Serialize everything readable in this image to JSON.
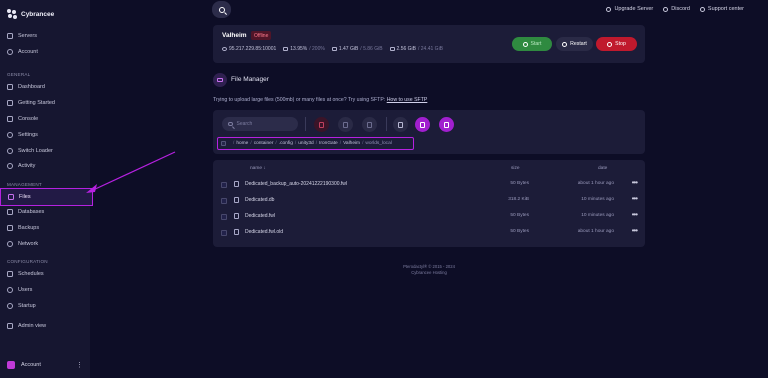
{
  "app": {
    "name": "Cybrancee"
  },
  "sidebar": {
    "top_items": [
      {
        "label": "Servers"
      },
      {
        "label": "Account"
      }
    ],
    "sections": [
      {
        "title": "GENERAL"
      },
      {
        "title": "MANAGEMENT"
      },
      {
        "title": "CONFIGURATION"
      }
    ],
    "general_items": [
      {
        "label": "Dashboard"
      },
      {
        "label": "Getting Started"
      },
      {
        "label": "Console"
      },
      {
        "label": "Settings"
      },
      {
        "label": "Switch Loader"
      },
      {
        "label": "Activity"
      }
    ],
    "management_items": [
      {
        "label": "Files"
      },
      {
        "label": "Databases"
      },
      {
        "label": "Backups"
      },
      {
        "label": "Network"
      }
    ],
    "configuration_items": [
      {
        "label": "Schedules"
      },
      {
        "label": "Users"
      },
      {
        "label": "Startup"
      }
    ],
    "admin_item": {
      "label": "Admin view"
    },
    "account_bar": {
      "label": "Account",
      "menu": "⋮"
    }
  },
  "topbar": {
    "links": [
      {
        "label": "Upgrade Server",
        "icon": "upgrade-icon"
      },
      {
        "label": "Discord",
        "icon": "discord-icon"
      },
      {
        "label": "Support center",
        "icon": "support-icon"
      }
    ]
  },
  "server": {
    "name": "Valheim",
    "status": "Offline",
    "address": "95.217.229.85:10001",
    "cpu": "13.95%",
    "cpu_limit": "/ 200%",
    "memory": "1.47 GiB",
    "memory_limit": "/ 5.86 GiB",
    "disk": "2.56 GiB",
    "disk_limit": "/ 24.41 GiB",
    "buttons": {
      "start": "Start",
      "restart": "Restart",
      "stop": "Stop"
    },
    "colors": {
      "start": "#2f8a40",
      "stop": "#c0192d",
      "offline": "#ff7b8e"
    }
  },
  "file_manager": {
    "title": "File Manager",
    "sftp_note": "Trying to upload large files (500mb) or many files at once? Try using SFTP:",
    "sftp_link": "How to use SFTP",
    "search_placeholder": "Search",
    "breadcrumb": [
      "home",
      "container",
      ".config",
      "unity3d",
      "IronGate",
      "Valheim",
      "worlds_local"
    ],
    "columns": {
      "name": "name ↓",
      "size": "size",
      "date": "date"
    },
    "files": [
      {
        "name": "Dedicated_backup_auto-20241222190300.fwl",
        "size": "50 Bytes",
        "modified": "about 1 hour ago"
      },
      {
        "name": "Dedicated.db",
        "size": "318.2 KiB",
        "modified": "10 minutes ago"
      },
      {
        "name": "Dedicated.fwl",
        "size": "50 Bytes",
        "modified": "10 minutes ago"
      },
      {
        "name": "Dedicated.fwl.old",
        "size": "50 Bytes",
        "modified": "about 1 hour ago"
      }
    ],
    "row_menu": "•••"
  },
  "footer": {
    "line1": "Pterodactyl® © 2015 - 2024",
    "line2": "Cybrancee Hosting"
  },
  "accent": "#b521e0"
}
